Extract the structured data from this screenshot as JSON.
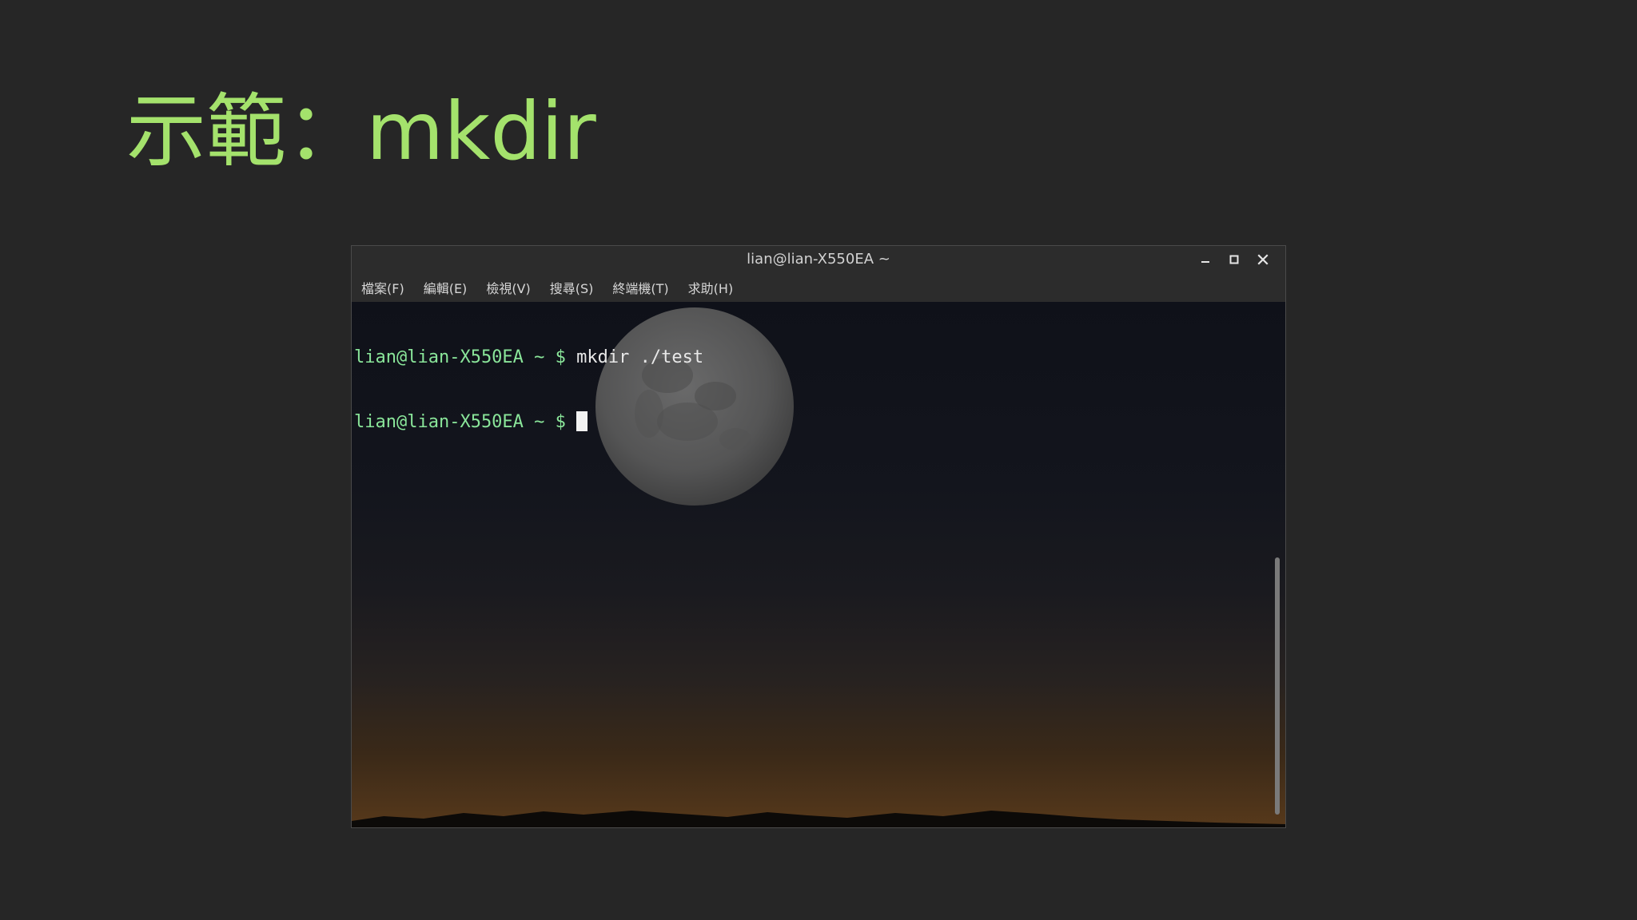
{
  "slide": {
    "title": "示範：mkdir"
  },
  "window": {
    "title": "lian@lian-X550EA ~",
    "controls": {
      "minimize_icon": "minimize-icon",
      "maximize_icon": "maximize-icon",
      "close_icon": "close-icon"
    },
    "menu": [
      {
        "label": "檔案(F)"
      },
      {
        "label": "編輯(E)"
      },
      {
        "label": "檢視(V)"
      },
      {
        "label": "搜尋(S)"
      },
      {
        "label": "終端機(T)"
      },
      {
        "label": "求助(H)"
      }
    ]
  },
  "terminal": {
    "lines": [
      {
        "prompt": "lian@lian-X550EA ~ $",
        "command": " mkdir ./test"
      },
      {
        "prompt": "lian@lian-X550EA ~ $",
        "command": " "
      }
    ],
    "background": "moon-night-sky",
    "colors": {
      "prompt": "#8ae69a",
      "text": "#e8e8e8",
      "title_accent": "#a4e26c"
    }
  }
}
